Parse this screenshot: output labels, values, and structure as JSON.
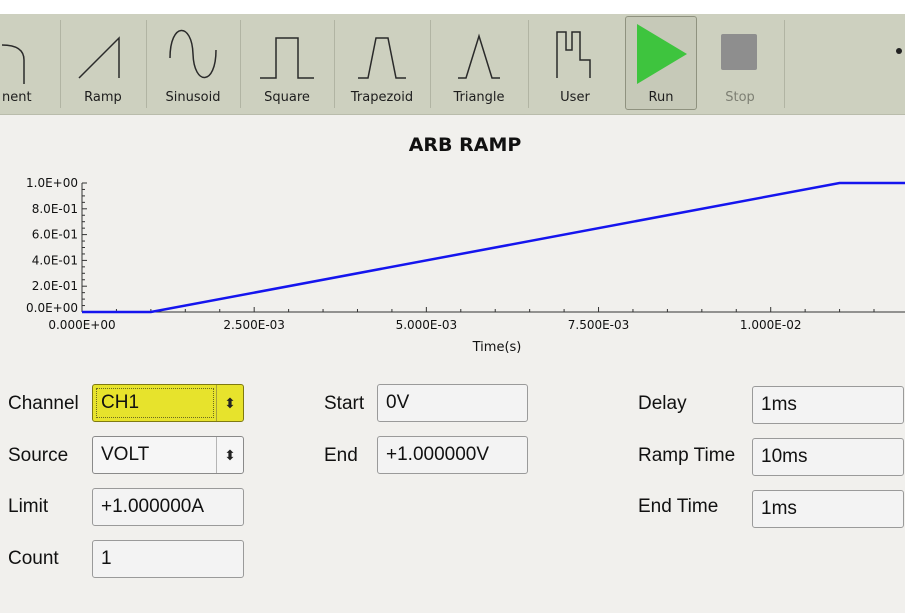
{
  "toolbar": {
    "items": [
      {
        "id": "nent",
        "label": "nent"
      },
      {
        "id": "ramp",
        "label": "Ramp"
      },
      {
        "id": "sinusoid",
        "label": "Sinusoid"
      },
      {
        "id": "square",
        "label": "Square"
      },
      {
        "id": "trapezoid",
        "label": "Trapezoid"
      },
      {
        "id": "triangle",
        "label": "Triangle"
      },
      {
        "id": "user",
        "label": "User"
      },
      {
        "id": "run",
        "label": "Run"
      },
      {
        "id": "stop",
        "label": "Stop"
      }
    ],
    "icons": {
      "run": "play-icon",
      "stop": "stop-icon"
    },
    "colors": {
      "run": "#3ec43e",
      "stop": "#8e8e8e",
      "toolbar_bg": "#cdd0bf"
    }
  },
  "chart_data": {
    "type": "line",
    "title": "ARB RAMP",
    "xlabel": "Time(s)",
    "ylabel": "",
    "xlim": [
      0,
      0.01195
    ],
    "ylim": [
      0,
      1.0
    ],
    "x_ticks": [
      0,
      0.0025,
      0.005,
      0.0075,
      0.01
    ],
    "x_tick_labels": [
      "0.000E+00",
      "2.500E-03",
      "5.000E-03",
      "7.500E-03",
      "1.000E-02"
    ],
    "y_ticks": [
      0,
      0.2,
      0.4,
      0.6,
      0.8,
      1.0
    ],
    "y_tick_labels": [
      "0.0E+00",
      "2.0E-01",
      "4.0E-01",
      "6.0E-01",
      "8.0E-01",
      "1.0E+00"
    ],
    "series": [
      {
        "x": [
          0,
          0.001,
          0.011,
          0.01195
        ],
        "y": [
          0,
          0,
          1.0,
          1.0
        ],
        "color": "#1515ee"
      }
    ],
    "grid": false
  },
  "form": {
    "channel": {
      "label": "Channel",
      "value": "CH1"
    },
    "source": {
      "label": "Source",
      "value": "VOLT"
    },
    "limit": {
      "label": "Limit",
      "value": "+1.000000A"
    },
    "count": {
      "label": "Count",
      "value": "1"
    },
    "start": {
      "label": "Start",
      "value": "0V"
    },
    "end": {
      "label": "End",
      "value": "+1.000000V"
    },
    "delay": {
      "label": "Delay",
      "value": "1ms"
    },
    "ramp_time": {
      "label": "Ramp Time",
      "value": "10ms"
    },
    "end_time": {
      "label": "End Time",
      "value": "1ms"
    },
    "select_icon": "updown-arrows-icon",
    "highlight_color": "#e7e32c"
  }
}
